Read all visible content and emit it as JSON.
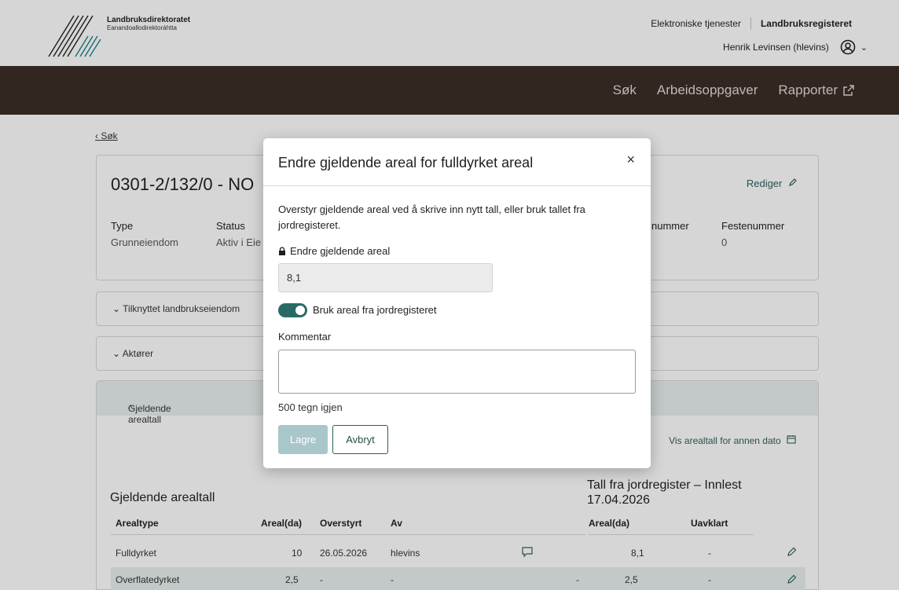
{
  "brand": {
    "name": "Landbruksdirektoratet",
    "subname": "Eanandoallodirektoráhtta"
  },
  "top_links": {
    "services": "Elektroniske tjenester",
    "registry": "Landbruksregisteret"
  },
  "user": {
    "display": "Henrik Levinsen (hlevins)"
  },
  "nav": {
    "items": [
      {
        "label": "Søk"
      },
      {
        "label": "Arbeidsoppgaver"
      },
      {
        "label": "Rapporter"
      }
    ]
  },
  "back_link": "Søk",
  "property": {
    "title": "0301-2/132/0 - NO",
    "edit_label": "Rediger",
    "fields": [
      {
        "label": "Type",
        "value": "Grunneiendom"
      },
      {
        "label": "Status",
        "value": "Aktiv i Eie"
      },
      {
        "label": "nummer",
        "value": ""
      },
      {
        "label": "Festenummer",
        "value": "0"
      }
    ]
  },
  "accordions": [
    {
      "label": "Tilknyttet landbrukseiendom"
    },
    {
      "label": "Aktører"
    },
    {
      "label": "Gjeldende arealtall"
    }
  ],
  "areal": {
    "vis_annen_dato": "Vis arealtall for annen dato",
    "title_left": "Gjeldende arealtall",
    "title_right": "Tall fra jordregister – Innlest 17.04.2026",
    "headers": [
      "Arealtype",
      "Areal(da)",
      "Overstyrt",
      "Av",
      "Areal(da)",
      "Uavklart"
    ],
    "rows": [
      {
        "type": "Fulldyrket",
        "areal": "10",
        "overstyrt": "26.05.2026",
        "av": "hlevins",
        "dash": "",
        "jord_areal": "8,1",
        "uavklart": "-"
      },
      {
        "type": "Overflatedyrket",
        "areal": "2,5",
        "overstyrt": "-",
        "av": "-",
        "dash": "-",
        "jord_areal": "2,5",
        "uavklart": "-"
      }
    ]
  },
  "modal": {
    "title": "Endre gjeldende areal for fulldyrket areal",
    "intro": "Overstyr gjeldende areal ved å skrive inn nytt tall, eller bruk tallet fra jordregisteret.",
    "field_label": "Endre gjeldende areal",
    "field_value": "8,1",
    "toggle_label": "Bruk areal fra jordregisteret",
    "toggle_on": true,
    "comment_label": "Kommentar",
    "comment_value": "",
    "chars_left": "500 tegn igjen",
    "save_label": "Lagre",
    "cancel_label": "Avbryt"
  },
  "colors": {
    "navbar": "#3a2c25",
    "accent": "#2a6a64",
    "highlight_row": "#dde5e4",
    "save_disabled": "#a9c6c9"
  }
}
